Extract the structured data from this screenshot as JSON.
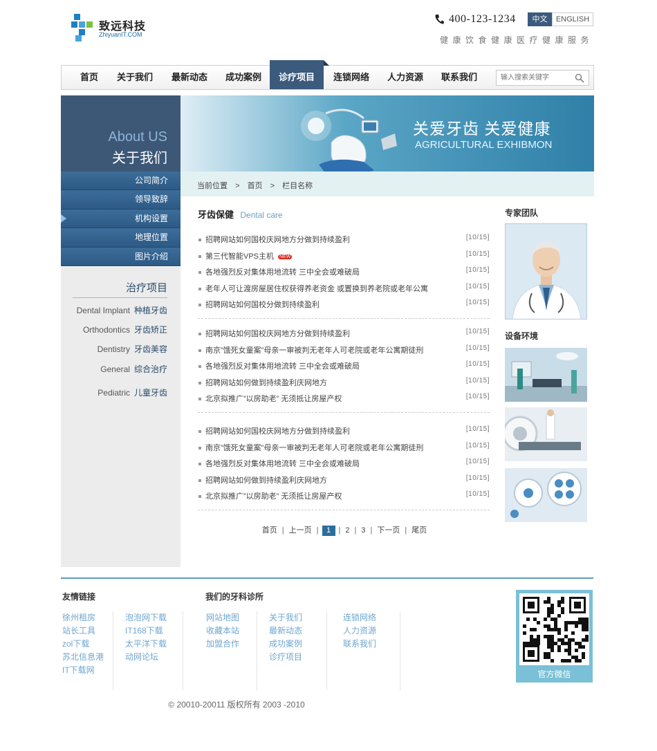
{
  "header": {
    "logo_name": "致远科技",
    "logo_sub": "ZhiyuanIT.COM",
    "phone": "400-123-1234",
    "lang_cn": "中文",
    "lang_en": "ENGLISH",
    "slogan": "健康饮食健康医疗健康服务"
  },
  "nav": {
    "items": [
      "首页",
      "关于我们",
      "最新动态",
      "成功案例",
      "诊疗项目",
      "连锁网络",
      "人力资源",
      "联系我们"
    ],
    "active_index": 4,
    "search_placeholder": "输入搜索关键字"
  },
  "sidebar": {
    "head_en": "About US",
    "head_cn": "关于我们",
    "menu": [
      "公司简介",
      "领导致辞",
      "机构设置",
      "地理位置",
      "图片介绍"
    ],
    "active_index": 2,
    "treat_title": "治疗项目",
    "treatments": [
      {
        "en": "Dental Implant",
        "cn": "种植牙齿"
      },
      {
        "en": "Orthodontics",
        "cn": "牙齿矫正"
      },
      {
        "en": "Dentistry",
        "cn": "牙齿美容"
      },
      {
        "en": "General",
        "cn": "综合治疗"
      },
      {
        "en": "Pediatric",
        "cn": "儿童牙齿"
      }
    ]
  },
  "banner": {
    "title_cn": "关爱牙齿  关爱健康",
    "title_en": "AGRICULTURAL EXHIBMON"
  },
  "breadcrumb": {
    "label": "当前位置",
    "sep": ">",
    "home": "首页",
    "current": "栏目名称"
  },
  "main": {
    "title_cn": "牙齿保健",
    "title_en": "Dental care",
    "groups": [
      [
        {
          "title": "招聘网站如何国校庆网地方分做到持续盈利",
          "date": "[10/15]"
        },
        {
          "title": "第三代智能VPS主机",
          "date": "[10/15]",
          "badge": "NEW"
        },
        {
          "title": "各地强烈反对集体用地流转 三中全会或难破局",
          "date": "[10/15]"
        },
        {
          "title": "老年人可让渡房屋居住权获得养老资金 或置换到养老院或老年公寓",
          "date": "[10/15]"
        },
        {
          "title": "招聘网站如何国校分做到持续盈利",
          "date": "[10/15]"
        }
      ],
      [
        {
          "title": "招聘网站如何国校庆网地方分做到持续盈利",
          "date": "[10/15]"
        },
        {
          "title": "南京”饿死女童案”母亲一审被判无老年人可老院或老年公寓期徒刑",
          "date": "[10/15]"
        },
        {
          "title": "各地强烈反对集体用地流转 三中全会或难破局",
          "date": "[10/15]"
        },
        {
          "title": "招聘网站如何做到持续盈利庆网地方",
          "date": "[10/15]"
        },
        {
          "title": "北京拟推广”以房助老” 无须抵让房屋产权",
          "date": "[10/15]"
        }
      ],
      [
        {
          "title": "招聘网站如何国校庆网地方分做到持续盈利",
          "date": "[10/15]"
        },
        {
          "title": "南京”饿死女童案”母亲一审被判无老年人可老院或老年公寓期徒刑",
          "date": "[10/15]"
        },
        {
          "title": "各地强烈反对集体用地流转 三中全会或难破局",
          "date": "[10/15]"
        },
        {
          "title": "招聘网站如何做到持续盈利庆网地方",
          "date": "[10/15]"
        },
        {
          "title": "北京拟推广”以房助老” 无须抵让房屋产权",
          "date": "[10/15]"
        }
      ]
    ]
  },
  "pager": {
    "first": "首页",
    "prev": "上一页",
    "pages": [
      "1",
      "2",
      "3"
    ],
    "current": "1",
    "next": "下一页",
    "last": "尾页",
    "sep": "|"
  },
  "right": {
    "team_title": "专家团队",
    "env_title": "设备环境"
  },
  "footer": {
    "links_title": "友情链接",
    "clinic_title": "我们的牙科诊所",
    "links_col1": [
      "徐州租房",
      "站长工具",
      "zol下载",
      "苏北信息港",
      "IT下载网"
    ],
    "links_col2": [
      "泡泡网下载",
      "IT168下载",
      "太平洋下载",
      "动网论坛"
    ],
    "clinic_col1": [
      "网站地图",
      "收藏本站",
      "加盟合作"
    ],
    "clinic_col2": [
      "关于我们",
      "最新动态",
      "成功案例",
      "诊疗项目"
    ],
    "clinic_col3": [
      "连锁网络",
      "人力资源",
      "联系我们"
    ],
    "qr_label": "官方微信",
    "copyright": "© 20010-20011 版权所有 2003 -2010"
  },
  "colors": {
    "nav_active": "#3b5a7c",
    "sidebar_menu": "#2d5a85",
    "accent_link": "#6fa6cf",
    "badge_new": "#d9261c"
  }
}
